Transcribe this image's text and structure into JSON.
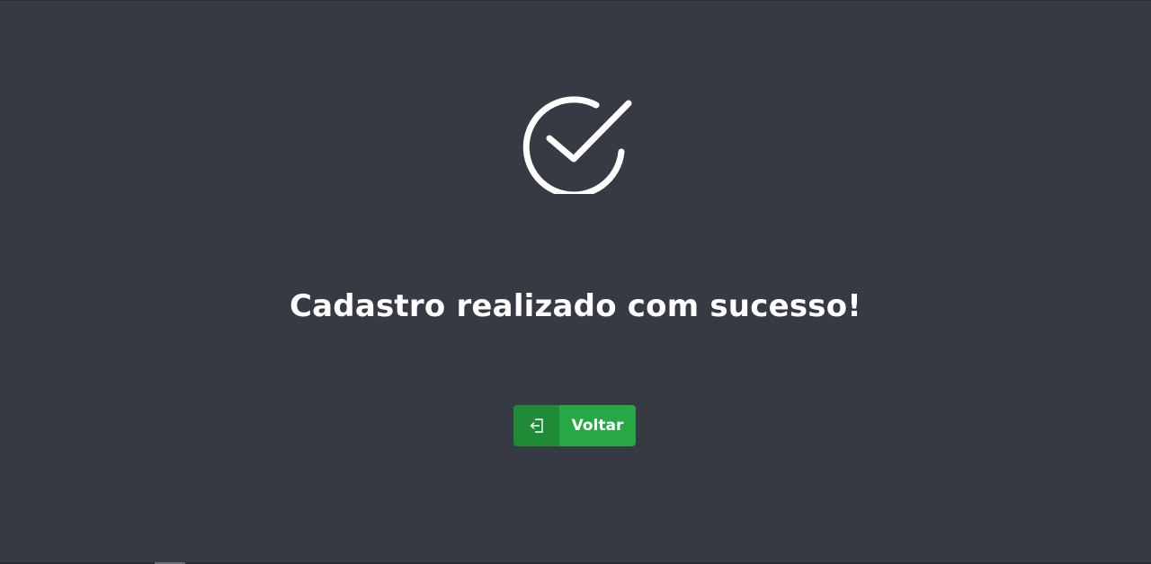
{
  "main": {
    "title": "Cadastro realizado com sucesso!",
    "icon": "check-circle-icon"
  },
  "actions": {
    "back_label": "Voltar",
    "back_icon": "sign-in-icon"
  },
  "colors": {
    "background": "#363a42",
    "button_primary": "#28a745",
    "button_icon_bg": "#1f8b36",
    "text": "#ffffff"
  }
}
